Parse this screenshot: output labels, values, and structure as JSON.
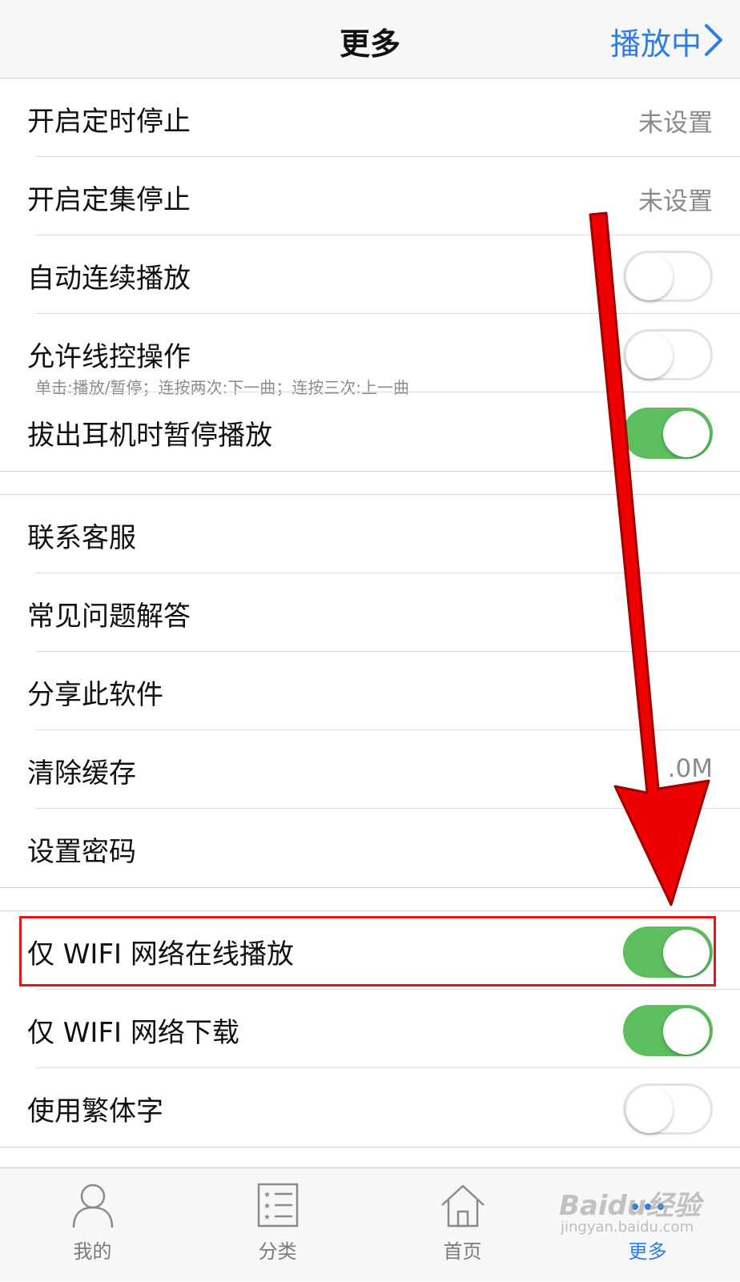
{
  "nav": {
    "title": "更多",
    "right_label": "播放中"
  },
  "section1": [
    {
      "label": "开启定时停止",
      "value": "未设置"
    },
    {
      "label": "开启定集停止",
      "value": "未设置"
    },
    {
      "label": "自动连续播放",
      "toggle": false
    },
    {
      "label": "允许线控操作",
      "toggle": false,
      "sub": "单击:播放/暂停；连按两次:下一曲；连按三次:上一曲"
    },
    {
      "label": "拔出耳机时暂停播放",
      "toggle": true
    }
  ],
  "section2": [
    {
      "label": "联系客服"
    },
    {
      "label": "常见问题解答"
    },
    {
      "label": "分享此软件"
    },
    {
      "label": "清除缓存",
      "value": ".0M"
    },
    {
      "label": "设置密码"
    }
  ],
  "section3": [
    {
      "label": "仅 WIFI 网络在线播放",
      "toggle": true
    },
    {
      "label": "仅 WIFI 网络下载",
      "toggle": true
    },
    {
      "label": "使用繁体字",
      "toggle": false
    }
  ],
  "tabbar": [
    {
      "label": "我的",
      "icon": "person-icon",
      "active": false
    },
    {
      "label": "分类",
      "icon": "list-icon",
      "active": false
    },
    {
      "label": "首页",
      "icon": "home-icon",
      "active": false
    },
    {
      "label": "更多",
      "icon": "more-icon",
      "active": true
    }
  ],
  "watermark": {
    "brand": "Baidu经验",
    "url": "jingyan.baidu.com"
  },
  "colors": {
    "accent": "#2f7de1",
    "toggle_on": "#5cbe5e",
    "annotation": "#e01818"
  }
}
